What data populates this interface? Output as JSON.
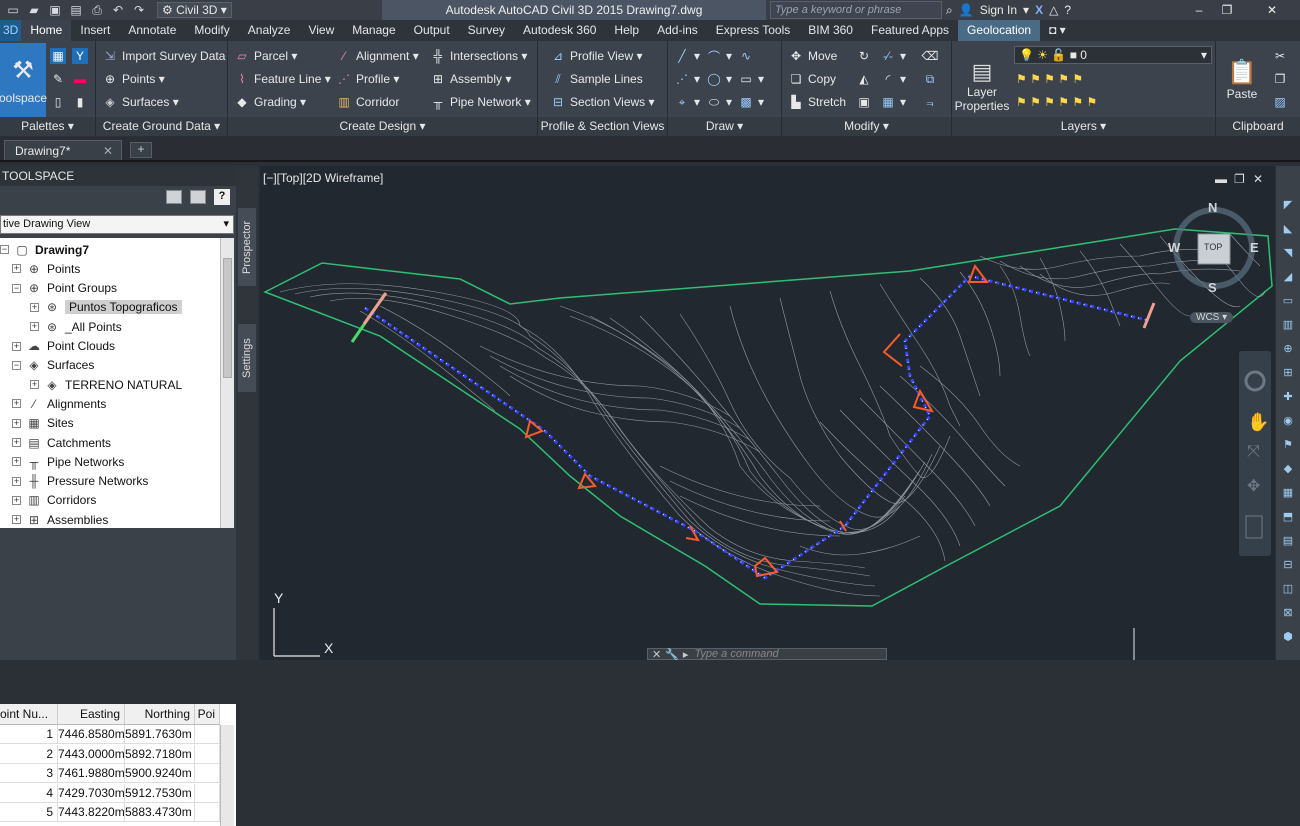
{
  "titlebar": {
    "workspace": "Civil 3D",
    "app_title": "Autodesk AutoCAD Civil 3D 2015    Drawing7.dwg",
    "search_placeholder": "Type a keyword or phrase",
    "sign_in": "Sign In"
  },
  "tabs": [
    "Home",
    "Insert",
    "Annotate",
    "Modify",
    "Analyze",
    "View",
    "Manage",
    "Output",
    "Survey",
    "Autodesk 360",
    "Help",
    "Add-ins",
    "Express Tools",
    "BIM 360",
    "Featured Apps",
    "Geolocation"
  ],
  "ribbon": {
    "palettes": {
      "title": "Palettes",
      "big_label": "oolspace"
    },
    "ground": {
      "title": "Create Ground Data",
      "items": [
        "Import Survey Data",
        "Points",
        "Surfaces"
      ]
    },
    "design": {
      "title": "Create Design",
      "items": [
        "Parcel",
        "Feature Line",
        "Grading",
        "Alignment",
        "Profile",
        "Corridor",
        "Intersections",
        "Assembly",
        "Pipe Network"
      ]
    },
    "profile": {
      "title": "Profile & Section Views",
      "items": [
        "Profile View",
        "Sample Lines",
        "Section Views"
      ]
    },
    "draw": {
      "title": "Draw"
    },
    "modify": {
      "title": "Modify",
      "items": [
        "Move",
        "Copy",
        "Stretch"
      ]
    },
    "layers": {
      "title": "Layers",
      "big_label_1": "Layer",
      "big_label_2": "Properties",
      "layer_value": "0"
    },
    "clipboard": {
      "title": "Clipboard",
      "big_label": "Paste"
    }
  },
  "doc_tab": "Drawing7*",
  "toolspace": {
    "header": "TOOLSPACE",
    "view_select": "tive Drawing View",
    "tree": [
      {
        "label": "Drawing7",
        "depth": 0
      },
      {
        "label": "Points",
        "depth": 1
      },
      {
        "label": "Point Groups",
        "depth": 1
      },
      {
        "label": "Puntos Topograficos",
        "depth": 2
      },
      {
        "label": "_All Points",
        "depth": 2
      },
      {
        "label": "Point Clouds",
        "depth": 1
      },
      {
        "label": "Surfaces",
        "depth": 1
      },
      {
        "label": "TERRENO NATURAL",
        "depth": 2
      },
      {
        "label": "Alignments",
        "depth": 1
      },
      {
        "label": "Sites",
        "depth": 1
      },
      {
        "label": "Catchments",
        "depth": 1
      },
      {
        "label": "Pipe Networks",
        "depth": 1
      },
      {
        "label": "Pressure Networks",
        "depth": 1
      },
      {
        "label": "Corridors",
        "depth": 1
      },
      {
        "label": "Assemblies",
        "depth": 1
      }
    ],
    "side_tabs": [
      "Prospector",
      "Settings"
    ],
    "grid": {
      "headers": [
        "oint Nu...",
        "Easting",
        "Northing",
        "Poi"
      ],
      "rows": [
        [
          "1",
          "7446.8580m",
          "5891.7630m"
        ],
        [
          "2",
          "7443.0000m",
          "5892.7180m"
        ],
        [
          "3",
          "7461.9880m",
          "5900.9240m"
        ],
        [
          "4",
          "7429.7030m",
          "5912.7530m"
        ],
        [
          "5",
          "7443.8220m",
          "5883.4730m"
        ]
      ]
    }
  },
  "viewport": {
    "label": "[−][Top][2D Wireframe]",
    "compass_n": "N",
    "compass_s": "S",
    "compass_w": "W",
    "compass_e": "E",
    "top": "TOP",
    "wcs": "WCS",
    "axis_y": "Y",
    "axis_x": "X"
  },
  "command_placeholder": "Type a command"
}
